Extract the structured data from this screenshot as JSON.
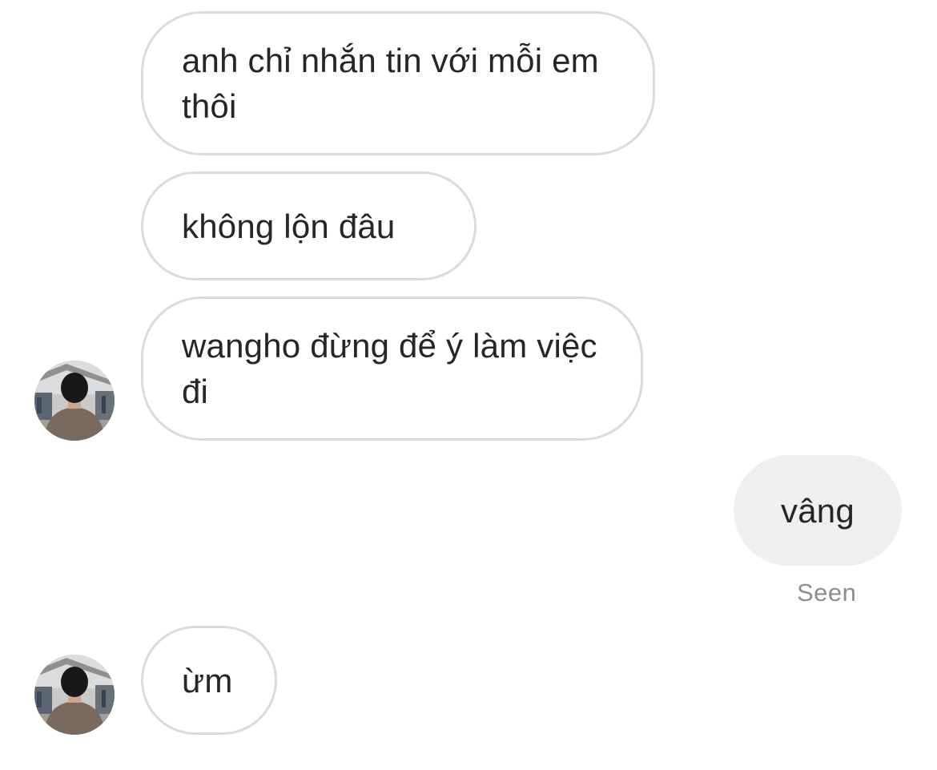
{
  "messages": [
    {
      "from": "other",
      "text": "anh chỉ nhắn tin với mỗi em thôi"
    },
    {
      "from": "other",
      "text": "không lộn đâu"
    },
    {
      "from": "other",
      "text": "wangho đừng để ý làm việc đi"
    },
    {
      "from": "me",
      "text": "vâng"
    },
    {
      "from": "other",
      "text": "ừm"
    }
  ],
  "status": {
    "seen_label": "Seen"
  },
  "colors": {
    "incoming_border": "#dbdbdb",
    "outgoing_bg": "#efefef",
    "text": "#262626",
    "seen": "#8e8e8e"
  },
  "icons": {
    "avatar": "user-avatar-photo"
  }
}
